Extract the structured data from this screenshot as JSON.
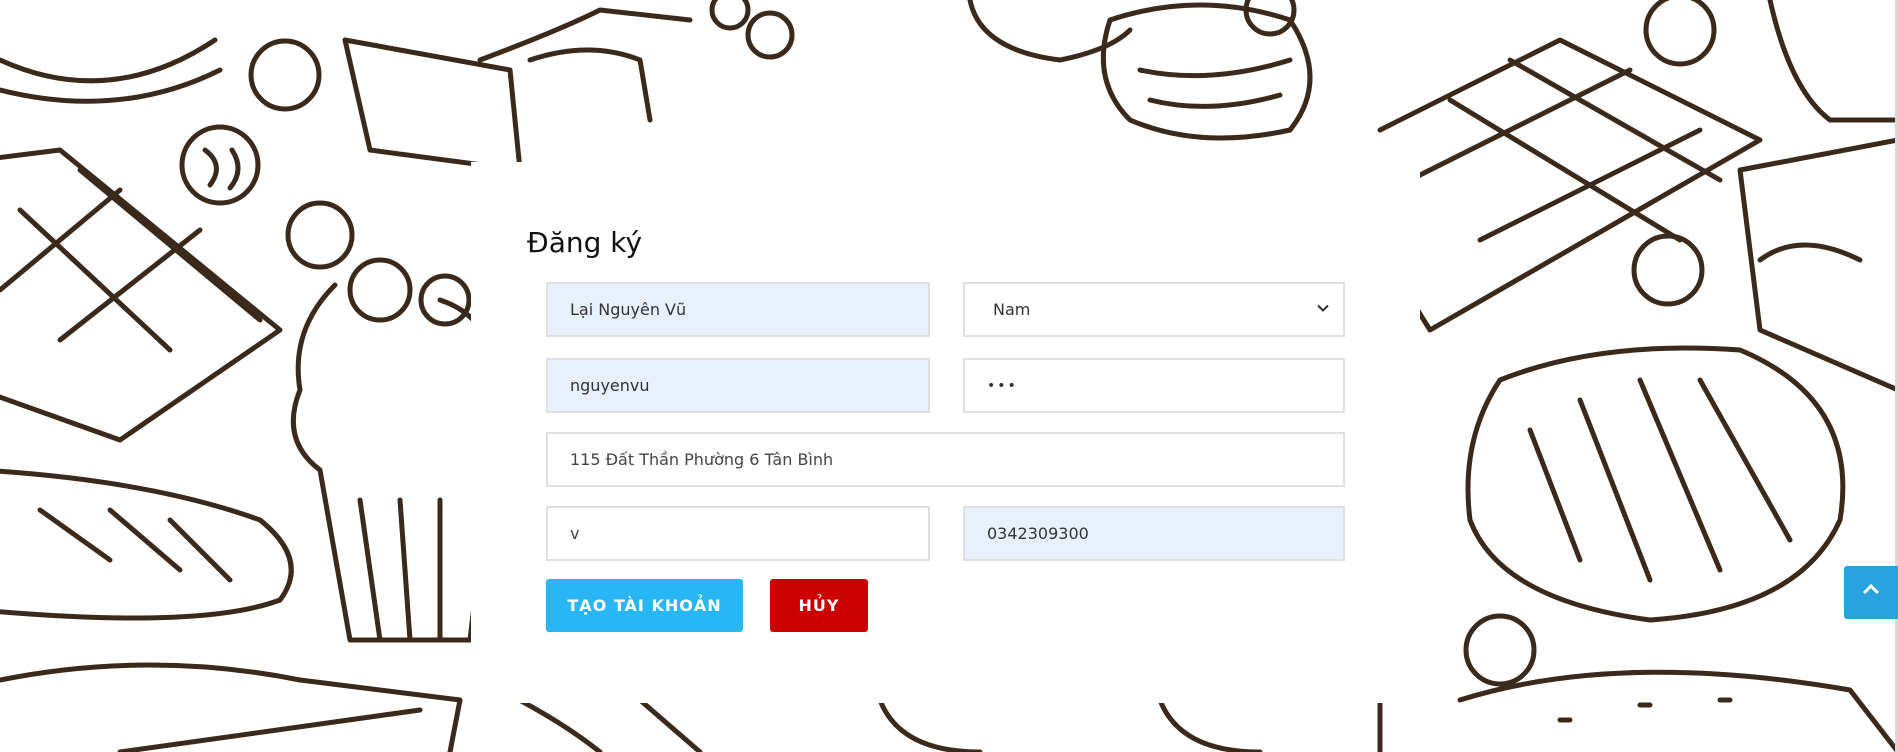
{
  "form": {
    "title": "Đăng ký",
    "full_name": "Lại Nguyên Vũ",
    "gender": "Nam",
    "username": "nguyenvu",
    "password": "•••",
    "address": "115 Đất Thần Phường 6 Tân Bình",
    "email": "v",
    "phone": "0342309300"
  },
  "buttons": {
    "create": "TẠO TÀI KHOẢN",
    "cancel": "HỦY"
  },
  "colors": {
    "create_button": "#29b6f6",
    "cancel_button": "#cc0000",
    "autofill_bg": "#e8f0fe",
    "doodle_stroke": "#3b2a1c"
  },
  "icons": {
    "gender_select": "chevron-down-icon",
    "back_to_top": "chevron-up-icon"
  }
}
